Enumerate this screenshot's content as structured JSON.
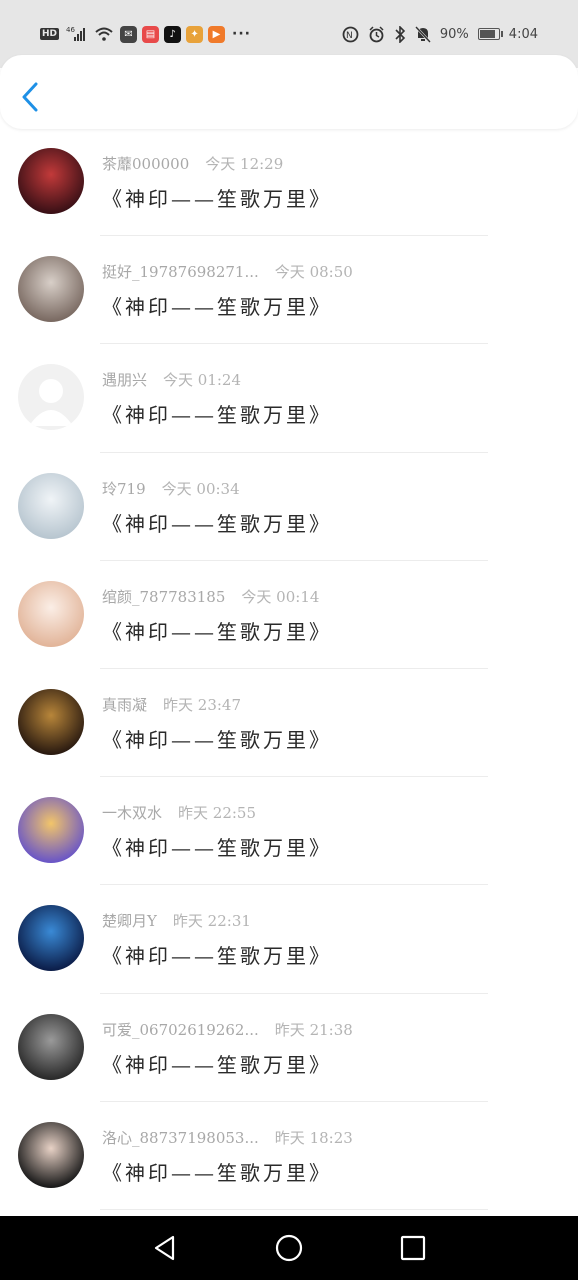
{
  "status_bar": {
    "network": "HD",
    "signal_label": "46",
    "battery_pct": "90%",
    "time": "4:04",
    "apps": [
      {
        "icon": "message-app-icon",
        "color": "#444444",
        "glyph": "✉"
      },
      {
        "icon": "red-book-app-icon",
        "color": "#e84a4a",
        "glyph": "▤"
      },
      {
        "icon": "tiktok-app-icon",
        "color": "#111111",
        "glyph": "♪"
      },
      {
        "icon": "color-grid-app-icon",
        "color": "#e8a23a",
        "glyph": "✦"
      },
      {
        "icon": "video-play-app-icon",
        "color": "#f07a2a",
        "glyph": "▶"
      }
    ]
  },
  "header": {
    "back_icon": "chevron-left-icon",
    "accent": "#1e90e6"
  },
  "messages": [
    {
      "user": "茶蘼000000",
      "time": "今天 12:29",
      "text": "《神印——笙歌万里》",
      "avatar_colors": [
        "#3a1016",
        "#c23a3a"
      ]
    },
    {
      "user": "挺好_19787698271...",
      "time": "今天 08:50",
      "text": "《神印——笙歌万里》",
      "avatar_colors": [
        "#7a6a62",
        "#d8cfc8"
      ]
    },
    {
      "user": "遇朋兴",
      "time": "今天 01:24",
      "text": "《神印——笙歌万里》",
      "avatar_colors": [
        "#eeeeee",
        "#ffffff"
      ]
    },
    {
      "user": "玲719",
      "time": "今天 00:34",
      "text": "《神印——笙歌万里》",
      "avatar_colors": [
        "#b8c6d0",
        "#f0f4f7"
      ]
    },
    {
      "user": "绾颜_787783185",
      "time": "今天 00:14",
      "text": "《神印——笙歌万里》",
      "avatar_colors": [
        "#e2b59a",
        "#fbeee6"
      ]
    },
    {
      "user": "真雨凝",
      "time": "昨天 23:47",
      "text": "《神印——笙歌万里》",
      "avatar_colors": [
        "#2a1a10",
        "#b8863a"
      ]
    },
    {
      "user": "一木双水",
      "time": "昨天 22:55",
      "text": "《神印——笙歌万里》",
      "avatar_colors": [
        "#6a56c6",
        "#f2c56a"
      ]
    },
    {
      "user": "楚卿月Y",
      "time": "昨天 22:31",
      "text": "《神印——笙歌万里》",
      "avatar_colors": [
        "#0c1e4a",
        "#3a8ad6"
      ]
    },
    {
      "user": "可爱_06702619262...",
      "time": "昨天 21:38",
      "text": "《神印——笙歌万里》",
      "avatar_colors": [
        "#2a2a2a",
        "#9a9a9a"
      ]
    },
    {
      "user": "洛心_88737198053...",
      "time": "昨天 18:23",
      "text": "《神印——笙歌万里》",
      "avatar_colors": [
        "#1a1a1a",
        "#e8d2c6"
      ]
    }
  ],
  "nav_bar": {
    "back": "triangle-back-icon",
    "home": "circle-home-icon",
    "recents": "square-recents-icon"
  }
}
